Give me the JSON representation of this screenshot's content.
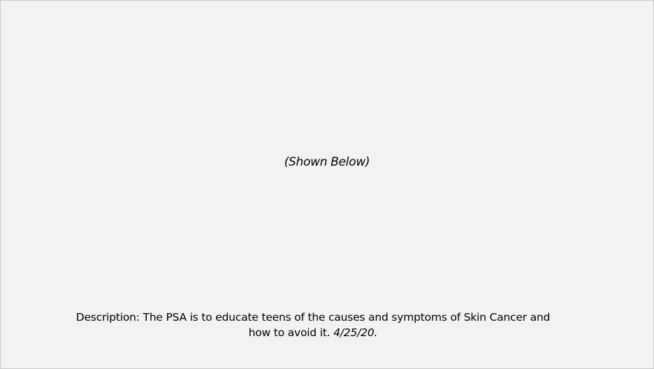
{
  "slide": {
    "subtitle": "(Shown Below)",
    "description": {
      "text": "Description: The PSA is to educate teens of the causes and symptoms of Skin Cancer and how to avoid it. ",
      "date": "4/25/20."
    }
  }
}
